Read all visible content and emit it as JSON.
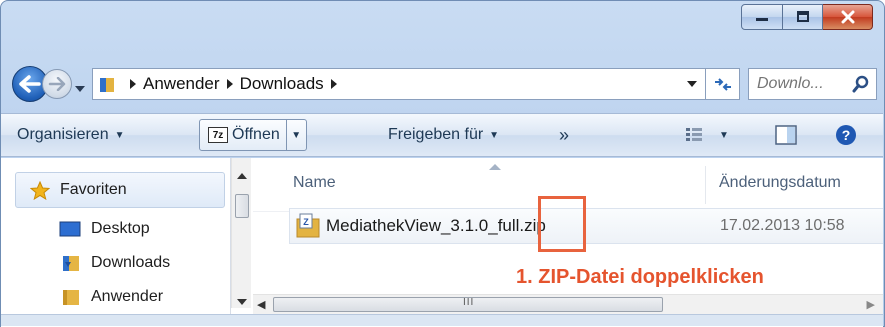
{
  "window": {
    "caption": {
      "minimize_icon": "minimize-icon",
      "maximize_icon": "maximize-icon",
      "close_icon": "close-icon"
    }
  },
  "address_bar": {
    "breadcrumbs": [
      "Anwender",
      "Downloads"
    ],
    "search_placeholder": "Downlo..."
  },
  "toolbar": {
    "organize": "Organisieren",
    "open": "Öffnen",
    "share": "Freigeben für",
    "more": "»"
  },
  "sidebar": {
    "items": [
      {
        "label": "Favoriten",
        "icon": "star-icon"
      },
      {
        "label": "Desktop",
        "icon": "desktop-icon"
      },
      {
        "label": "Downloads",
        "icon": "downloads-folder-icon"
      },
      {
        "label": "Anwender",
        "icon": "user-folder-icon"
      }
    ]
  },
  "columns": {
    "name": "Name",
    "date": "Änderungsdatum"
  },
  "files": [
    {
      "name": "MediathekView_3.1.0_full.zip",
      "date": "17.02.2013 10:58",
      "icon": "zip-archive-icon"
    }
  ],
  "annotation": {
    "text": "1. ZIP-Datei doppelklicken",
    "color": "#e5542e"
  }
}
